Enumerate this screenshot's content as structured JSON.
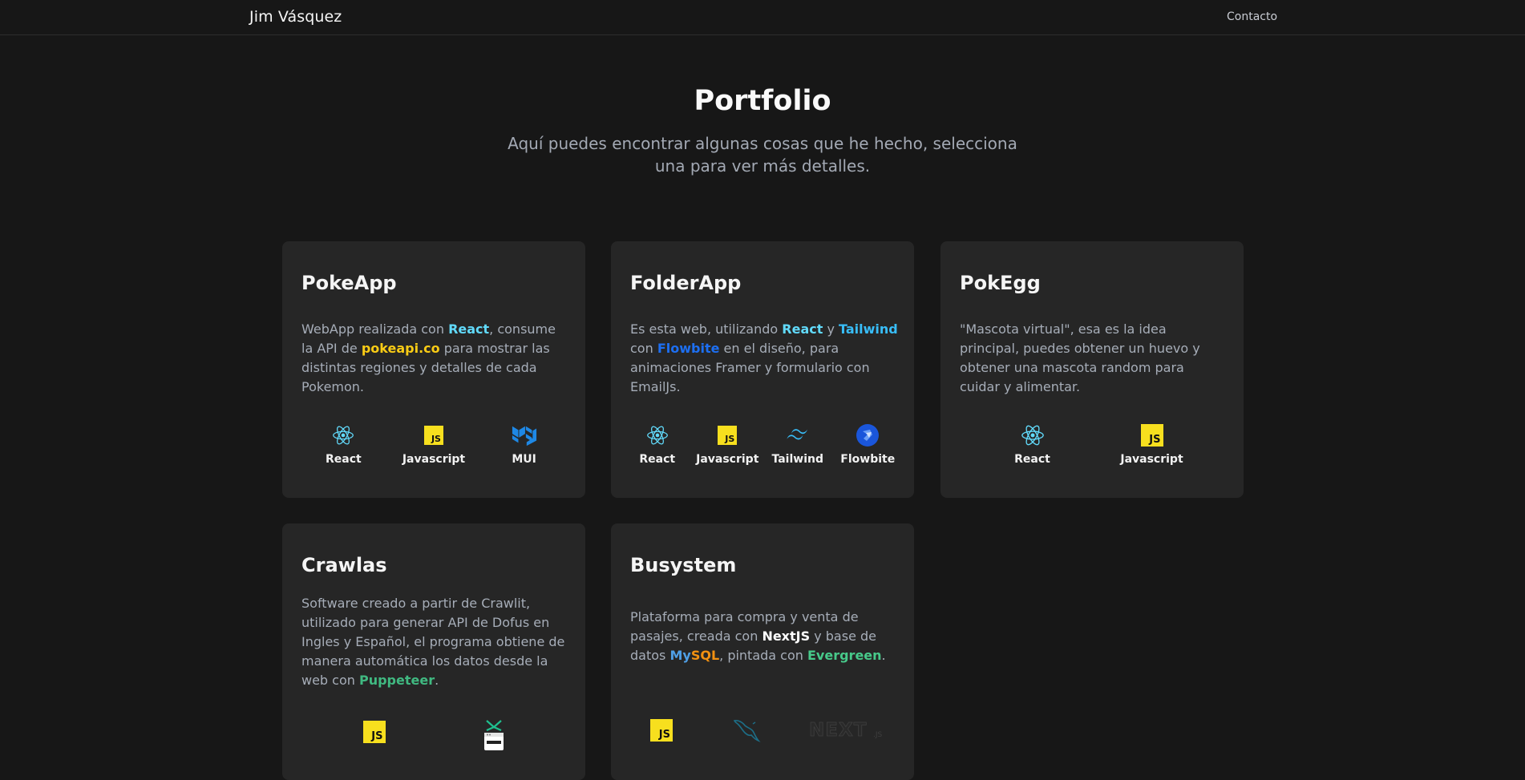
{
  "header": {
    "brand": "Jim Vásquez",
    "nav_contact": "Contacto"
  },
  "hero": {
    "title": "Portfolio",
    "subtitle": "Aquí puedes encontrar algunas cosas que he hecho, selecciona una para ver más detalles."
  },
  "colors": {
    "react": "#61dafb",
    "pokeapi": "#facc15",
    "tailwind": "#38bdf8",
    "flowbite": "#1d6ff2",
    "puppeteer": "#40b981",
    "nextjs": "#ffffff",
    "mysql_blue": "#4f9fe6",
    "mysql_orange": "#f29111",
    "evergreen": "#47c98a"
  },
  "cards": [
    {
      "title": "PokeApp",
      "desc": {
        "t1": "WebApp realizada con ",
        "h1": "React",
        "t2": ", consume la API de ",
        "h2": "pokeapi.co",
        "t3": " para mostrar las distintas regiones y detalles de cada Pokemon."
      },
      "techs": [
        {
          "label": "React",
          "icon": "react-icon"
        },
        {
          "label": "Javascript",
          "icon": "javascript-icon"
        },
        {
          "label": "MUI",
          "icon": "mui-icon"
        }
      ]
    },
    {
      "title": "FolderApp",
      "desc": {
        "t1": "Es esta web, utilizando ",
        "h1": "React",
        "t2": " y ",
        "h2": "Tailwind",
        "t3": " con ",
        "h3": "Flowbite",
        "t4": " en el diseño, para animaciones Framer y formulario con EmailJs."
      },
      "techs": [
        {
          "label": "React",
          "icon": "react-icon"
        },
        {
          "label": "Javascript",
          "icon": "javascript-icon"
        },
        {
          "label": "Tailwind",
          "icon": "tailwind-icon"
        },
        {
          "label": "Flowbite",
          "icon": "flowbite-icon"
        }
      ]
    },
    {
      "title": "PokEgg",
      "desc": {
        "t1": "\"Mascota virtual\", esa es la idea principal, puedes obtener un huevo y obtener una mascota random para cuidar y alimentar."
      },
      "techs": [
        {
          "label": "React",
          "icon": "react-icon"
        },
        {
          "label": "Javascript",
          "icon": "javascript-icon"
        }
      ]
    },
    {
      "title": "Crawlas",
      "desc": {
        "t1": "Software creado a partir de Crawlit, utilizado para generar API de Dofus en Ingles y Español, el programa obtiene de manera automática los datos desde la web con ",
        "h1": "Puppeteer",
        "t2": "."
      },
      "techs": [
        {
          "icon": "javascript-icon"
        },
        {
          "icon": "puppeteer-icon"
        }
      ]
    },
    {
      "title": "Busystem",
      "desc": {
        "t1": "Plataforma para compra y venta de pasajes, creada con ",
        "h1": "NextJS",
        "t2": " y base de datos ",
        "h2a": "My",
        "h2b": "SQL",
        "t3": ", pintada con ",
        "h3": "Evergreen",
        "t4": "."
      },
      "techs": [
        {
          "icon": "javascript-icon"
        },
        {
          "icon": "mysql-icon"
        },
        {
          "icon": "nextjs-icon"
        }
      ]
    }
  ]
}
